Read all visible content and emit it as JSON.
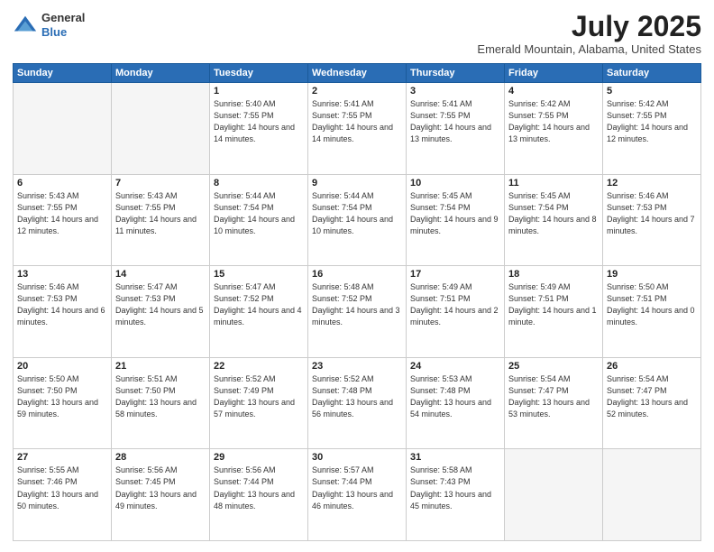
{
  "header": {
    "logo_line1": "General",
    "logo_line2": "Blue",
    "title": "July 2025",
    "subtitle": "Emerald Mountain, Alabama, United States"
  },
  "weekdays": [
    "Sunday",
    "Monday",
    "Tuesday",
    "Wednesday",
    "Thursday",
    "Friday",
    "Saturday"
  ],
  "weeks": [
    [
      {
        "day": "",
        "info": ""
      },
      {
        "day": "",
        "info": ""
      },
      {
        "day": "1",
        "info": "Sunrise: 5:40 AM\nSunset: 7:55 PM\nDaylight: 14 hours and 14 minutes."
      },
      {
        "day": "2",
        "info": "Sunrise: 5:41 AM\nSunset: 7:55 PM\nDaylight: 14 hours and 14 minutes."
      },
      {
        "day": "3",
        "info": "Sunrise: 5:41 AM\nSunset: 7:55 PM\nDaylight: 14 hours and 13 minutes."
      },
      {
        "day": "4",
        "info": "Sunrise: 5:42 AM\nSunset: 7:55 PM\nDaylight: 14 hours and 13 minutes."
      },
      {
        "day": "5",
        "info": "Sunrise: 5:42 AM\nSunset: 7:55 PM\nDaylight: 14 hours and 12 minutes."
      }
    ],
    [
      {
        "day": "6",
        "info": "Sunrise: 5:43 AM\nSunset: 7:55 PM\nDaylight: 14 hours and 12 minutes."
      },
      {
        "day": "7",
        "info": "Sunrise: 5:43 AM\nSunset: 7:55 PM\nDaylight: 14 hours and 11 minutes."
      },
      {
        "day": "8",
        "info": "Sunrise: 5:44 AM\nSunset: 7:54 PM\nDaylight: 14 hours and 10 minutes."
      },
      {
        "day": "9",
        "info": "Sunrise: 5:44 AM\nSunset: 7:54 PM\nDaylight: 14 hours and 10 minutes."
      },
      {
        "day": "10",
        "info": "Sunrise: 5:45 AM\nSunset: 7:54 PM\nDaylight: 14 hours and 9 minutes."
      },
      {
        "day": "11",
        "info": "Sunrise: 5:45 AM\nSunset: 7:54 PM\nDaylight: 14 hours and 8 minutes."
      },
      {
        "day": "12",
        "info": "Sunrise: 5:46 AM\nSunset: 7:53 PM\nDaylight: 14 hours and 7 minutes."
      }
    ],
    [
      {
        "day": "13",
        "info": "Sunrise: 5:46 AM\nSunset: 7:53 PM\nDaylight: 14 hours and 6 minutes."
      },
      {
        "day": "14",
        "info": "Sunrise: 5:47 AM\nSunset: 7:53 PM\nDaylight: 14 hours and 5 minutes."
      },
      {
        "day": "15",
        "info": "Sunrise: 5:47 AM\nSunset: 7:52 PM\nDaylight: 14 hours and 4 minutes."
      },
      {
        "day": "16",
        "info": "Sunrise: 5:48 AM\nSunset: 7:52 PM\nDaylight: 14 hours and 3 minutes."
      },
      {
        "day": "17",
        "info": "Sunrise: 5:49 AM\nSunset: 7:51 PM\nDaylight: 14 hours and 2 minutes."
      },
      {
        "day": "18",
        "info": "Sunrise: 5:49 AM\nSunset: 7:51 PM\nDaylight: 14 hours and 1 minute."
      },
      {
        "day": "19",
        "info": "Sunrise: 5:50 AM\nSunset: 7:51 PM\nDaylight: 14 hours and 0 minutes."
      }
    ],
    [
      {
        "day": "20",
        "info": "Sunrise: 5:50 AM\nSunset: 7:50 PM\nDaylight: 13 hours and 59 minutes."
      },
      {
        "day": "21",
        "info": "Sunrise: 5:51 AM\nSunset: 7:50 PM\nDaylight: 13 hours and 58 minutes."
      },
      {
        "day": "22",
        "info": "Sunrise: 5:52 AM\nSunset: 7:49 PM\nDaylight: 13 hours and 57 minutes."
      },
      {
        "day": "23",
        "info": "Sunrise: 5:52 AM\nSunset: 7:48 PM\nDaylight: 13 hours and 56 minutes."
      },
      {
        "day": "24",
        "info": "Sunrise: 5:53 AM\nSunset: 7:48 PM\nDaylight: 13 hours and 54 minutes."
      },
      {
        "day": "25",
        "info": "Sunrise: 5:54 AM\nSunset: 7:47 PM\nDaylight: 13 hours and 53 minutes."
      },
      {
        "day": "26",
        "info": "Sunrise: 5:54 AM\nSunset: 7:47 PM\nDaylight: 13 hours and 52 minutes."
      }
    ],
    [
      {
        "day": "27",
        "info": "Sunrise: 5:55 AM\nSunset: 7:46 PM\nDaylight: 13 hours and 50 minutes."
      },
      {
        "day": "28",
        "info": "Sunrise: 5:56 AM\nSunset: 7:45 PM\nDaylight: 13 hours and 49 minutes."
      },
      {
        "day": "29",
        "info": "Sunrise: 5:56 AM\nSunset: 7:44 PM\nDaylight: 13 hours and 48 minutes."
      },
      {
        "day": "30",
        "info": "Sunrise: 5:57 AM\nSunset: 7:44 PM\nDaylight: 13 hours and 46 minutes."
      },
      {
        "day": "31",
        "info": "Sunrise: 5:58 AM\nSunset: 7:43 PM\nDaylight: 13 hours and 45 minutes."
      },
      {
        "day": "",
        "info": ""
      },
      {
        "day": "",
        "info": ""
      }
    ]
  ]
}
